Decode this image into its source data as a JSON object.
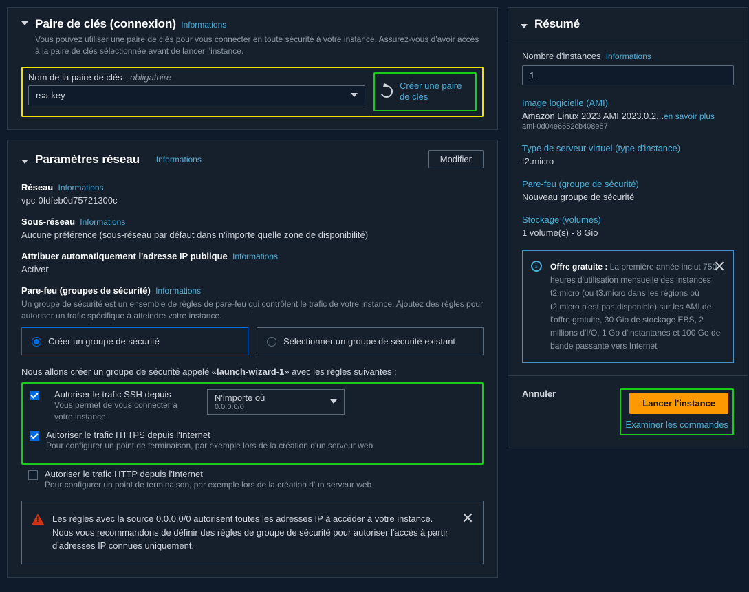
{
  "key_pair": {
    "title": "Paire de clés (connexion)",
    "info": "Informations",
    "desc": "Vous pouvez utiliser une paire de clés pour vous connecter en toute sécurité à votre instance. Assurez-vous d'avoir accès à la paire de clés sélectionnée avant de lancer l'instance.",
    "name_label": "Nom de la paire de clés",
    "required": "obligatoire",
    "value": "rsa-key",
    "create": "Créer une paire de clés"
  },
  "network": {
    "title": "Paramètres réseau",
    "info": "Informations",
    "edit": "Modifier",
    "reseau_lbl": "Réseau",
    "reseau_val": "vpc-0fdfeb0d75721300c",
    "subnet_lbl": "Sous-réseau",
    "subnet_val": "Aucune préférence (sous-réseau par défaut dans n'importe quelle zone de disponibilité)",
    "ip_lbl": "Attribuer automatiquement l'adresse IP publique",
    "ip_val": "Activer",
    "fw_lbl": "Pare-feu (groupes de sécurité)",
    "fw_desc": "Un groupe de sécurité est un ensemble de règles de pare-feu qui contrôlent le trafic de votre instance. Ajoutez des règles pour autoriser un trafic spécifique à atteindre votre instance.",
    "opt_create": "Créer un groupe de sécurité",
    "opt_existing": "Sélectionner un groupe de sécurité existant",
    "sg_text_pre": "Nous allons créer un groupe de sécurité appelé «",
    "sg_name": "launch-wizard-1",
    "sg_text_post": "» avec les règles suivantes :",
    "ssh_lbl": "Autoriser le trafic SSH depuis",
    "ssh_desc": "Vous permet de vous connecter à votre instance",
    "ssh_sel": "N'importe où",
    "ssh_cidr": "0.0.0.0/0",
    "https_lbl": "Autoriser le trafic HTTPS depuis l'Internet",
    "https_desc": "Pour configurer un point de terminaison, par exemple lors de la création d'un serveur web",
    "http_lbl": "Autoriser le trafic HTTP depuis l'Internet",
    "http_desc": "Pour configurer un point de terminaison, par exemple lors de la création d'un serveur web",
    "warn": "Les règles avec la source 0.0.0.0/0 autorisent toutes les adresses IP à accéder à votre instance. Nous vous recommandons de définir des règles de groupe de sécurité pour autoriser l'accès à partir d'adresses IP connues uniquement.",
    "info_link": "Informations"
  },
  "summary": {
    "title": "Résumé",
    "count_lbl": "Nombre d'instances",
    "count_val": "1",
    "ami_lbl": "Image logicielle (AMI)",
    "ami_val": "Amazon Linux 2023 AMI 2023.0.2...",
    "ami_more": "en savoir plus",
    "ami_id": "ami-0d04e6652cb408e57",
    "type_lbl": "Type de serveur virtuel (type d'instance)",
    "type_val": "t2.micro",
    "fw_lbl": "Pare-feu (groupe de sécurité)",
    "fw_val": "Nouveau groupe de sécurité",
    "storage_lbl": "Stockage (volumes)",
    "storage_val": "1 volume(s) - 8 Gio",
    "free_strong": "Offre gratuite :",
    "free_text": " La première année inclut 750 heures d'utilisation mensuelle des instances t2.micro (ou t3.micro dans les régions où t2.micro n'est pas disponible) sur les AMI de l'offre gratuite, 30 Gio de stockage EBS, 2 millions d'I/O, 1 Go d'instantanés et 100 Go de bande passante vers Internet",
    "cancel": "Annuler",
    "launch": "Lancer l'instance",
    "review": "Examiner les commandes",
    "info": "Informations"
  }
}
